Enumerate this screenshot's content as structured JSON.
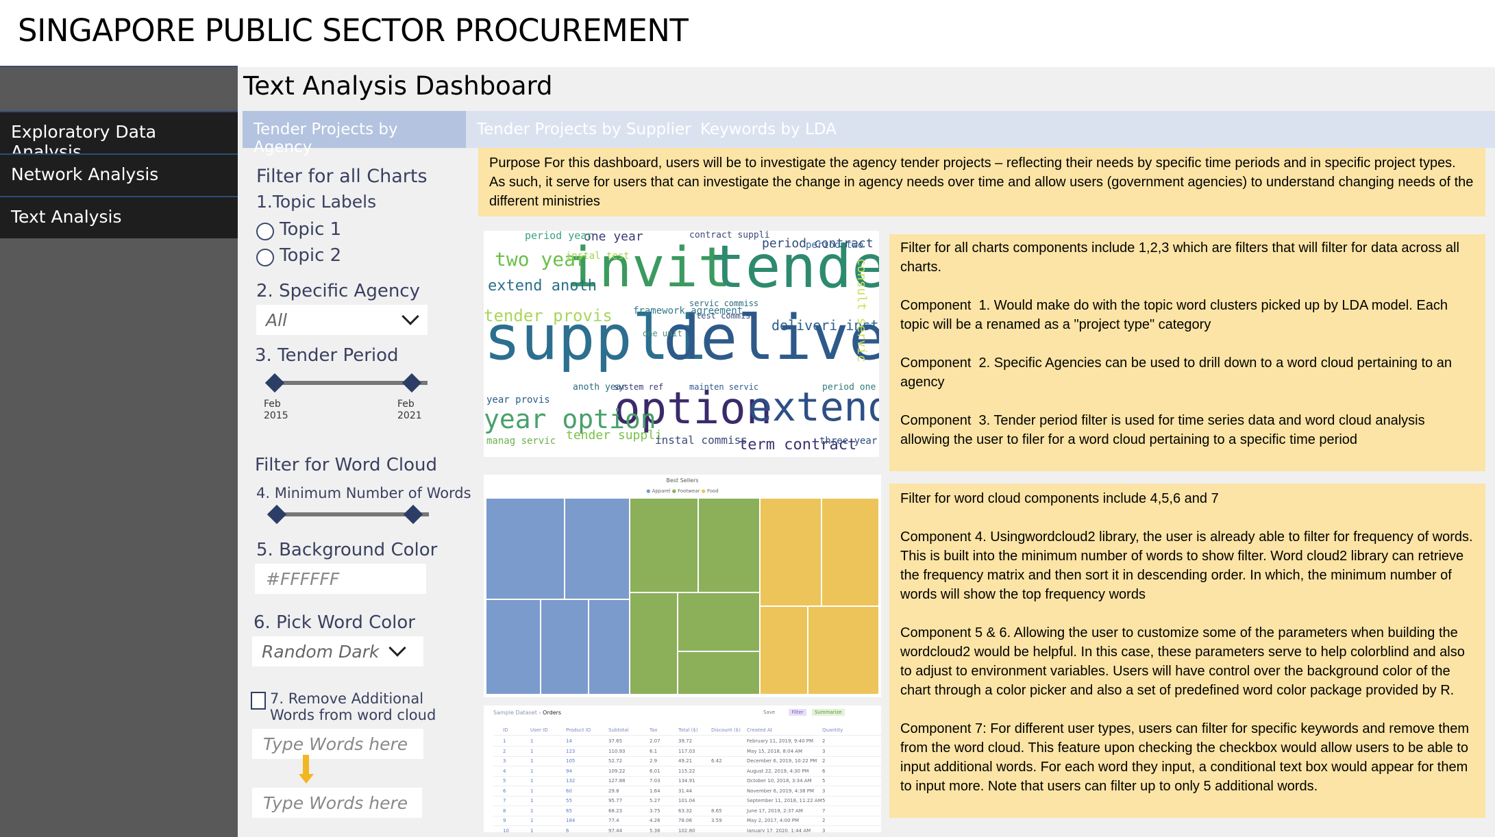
{
  "app": {
    "title": "SINGAPORE PUBLIC SECTOR PROCUREMENT"
  },
  "sidebar": {
    "items": [
      {
        "label": "Exploratory Data Analysis"
      },
      {
        "label": "Network Analysis"
      },
      {
        "label": "Text Analysis"
      }
    ]
  },
  "dashboard": {
    "title": "Text Analysis Dashboard"
  },
  "tabs": [
    {
      "label": "Tender Projects by Agency",
      "active": true
    },
    {
      "label": "Tender Projects by Supplier",
      "active": false
    },
    {
      "label": "Keywords by LDA",
      "active": false
    }
  ],
  "filters": {
    "all_heading": "Filter for all Charts",
    "topic_label": "1.Topic Labels",
    "topics": [
      "Topic 1",
      "Topic 2"
    ],
    "agency_label": "2. Specific Agency",
    "agency_value": "All",
    "period_label": "3. Tender Period",
    "period_start": {
      "month": "Feb",
      "year": "2015"
    },
    "period_end": {
      "month": "Feb",
      "year": "2021"
    },
    "wordcloud_heading": "Filter for Word Cloud",
    "min_words_label": "4. Minimum Number of Words",
    "bg_label": "5. Background Color",
    "bg_value": "#FFFFFF",
    "word_color_label": "6. Pick Word Color",
    "word_color_value": "Random Dark",
    "remove_label_1": "7. Remove Additional",
    "remove_label_2": "Words from word cloud",
    "input_placeholder_1": "Type Words here",
    "input_placeholder_2": "Type Words here"
  },
  "notes": {
    "purpose": "Purpose For this dashboard, users will be to investigate the agency tender projects – reflecting their needs by specific time periods and in specific project types. As such, it serve for users that can investigate the change in agency needs over time and allow users (government agencies) to understand changing needs of the different ministries",
    "all_charts": "Filter for all charts components include 1,2,3 which are filters that will filter for data across all charts.\n\nComponent  1. Would make do with the topic word clusters picked up by LDA model. Each topic will be a renamed as a \"project type\" category\n\nComponent  2. Specific Agencies can be used to drill down to a word cloud pertaining to an agency\n\nComponent  3. Tender period filter is used for time series data and word cloud analysis allowing the user to filer for a word cloud pertaining to a specific time period",
    "word_cloud": "Filter for word cloud components include 4,5,6 and 7\n\nComponent 4. Usingwordcloud2 library, the user is already able to filter for frequency of words. This is built into the minimum number of words to show filter. Word cloud2 library can retrieve the frequency matrix and then sort it in descending order. In which, the minimum number of words will show the top frequency words\n\nComponent 5 & 6. Allowing the user to customize some of the parameters when building the wordcloud2 would be helpful. In this case, these parameters serve to help colorblind and also to adjust to environment variables. Users will have control over the background color of the chart through a color picker and also a set of predefined word color package provided by R.\n\nComponent 7: For different user types, users can filter for specific keywords and remove them from the word cloud. This feature upon checking the checkbox would allow users to be able to input additional words. For each word they input, a conditional text box would appear for them to input more. Note that users can filter up to only 5 additional words."
  },
  "wordcloud": {
    "words": [
      {
        "text": "invit",
        "color": "#3b9a5f"
      },
      {
        "text": "tender",
        "color": "#2e8a6e"
      },
      {
        "text": "suppli",
        "color": "#2c6f8f"
      },
      {
        "text": "deliveri",
        "color": "#2e5a8a"
      },
      {
        "text": "option",
        "color": "#3b2a6a"
      },
      {
        "text": "extend",
        "color": "#2e4f86"
      },
      {
        "text": "year option",
        "color": "#4aa06a"
      },
      {
        "text": "two year",
        "color": "#6abf4a"
      },
      {
        "text": "tender provis",
        "color": "#a8d65a"
      },
      {
        "text": "extend anoth",
        "color": "#2a6f8a"
      },
      {
        "text": "period contract",
        "color": "#2f4a7a"
      },
      {
        "text": "deliveri instal",
        "color": "#2b5f8c"
      },
      {
        "text": "term contract",
        "color": "#3a3470"
      },
      {
        "text": "one year",
        "color": "#3a3a7a"
      },
      {
        "text": "consult servic",
        "color": "#c9e05a"
      },
      {
        "text": "period year",
        "color": "#3aa07a"
      },
      {
        "text": "contract suppli",
        "color": "#3a4a7a"
      },
      {
        "text": "framework agreement",
        "color": "#2f7a8a"
      },
      {
        "text": "servic commiss",
        "color": "#2e6a80"
      },
      {
        "text": "tender suppli",
        "color": "#7ac04a"
      },
      {
        "text": "instal commiss",
        "color": "#3a4a7a"
      },
      {
        "text": "three year",
        "color": "#2a4a7a"
      },
      {
        "text": "period two",
        "color": "#3a6a9a"
      },
      {
        "text": "manag servic",
        "color": "#6ab04a"
      },
      {
        "text": "year provis",
        "color": "#2a5a8a"
      },
      {
        "text": "period one",
        "color": "#2f7a7a"
      },
      {
        "text": "instal test",
        "color": "#9fd34a"
      },
      {
        "text": "anoth year",
        "color": "#2a6a7a"
      },
      {
        "text": "system ref",
        "color": "#3a3a7a"
      },
      {
        "text": "mainten servic",
        "color": "#2e5a8a"
      },
      {
        "text": "one unit",
        "color": "#4a8a7a"
      },
      {
        "text": "test commiss",
        "color": "#3a4a7a"
      }
    ]
  },
  "treemap": {
    "title": "Best Sellers",
    "legend": [
      "Apparel",
      "Footwear",
      "Food"
    ],
    "colors": [
      "#7b9bcc",
      "#8cb05a",
      "#ecc45a"
    ]
  },
  "sample_table": {
    "crumb_1": "Sample Dataset",
    "crumb_2": "Orders",
    "actions": [
      "Save",
      "Filter",
      "Summarize"
    ],
    "columns": [
      "ID",
      "User ID",
      "Product ID",
      "Subtotal",
      "Tax",
      "Total ($)",
      "Discount ($)",
      "Created At",
      "Quantity"
    ],
    "rows": [
      [
        "1",
        "1",
        "14",
        "37.65",
        "2.07",
        "39.72",
        "",
        "February 11, 2019, 9:40 PM",
        "2"
      ],
      [
        "2",
        "1",
        "123",
        "110.93",
        "6.1",
        "117.03",
        "",
        "May 15, 2018, 8:04 AM",
        "3"
      ],
      [
        "3",
        "1",
        "105",
        "52.72",
        "2.9",
        "49.21",
        "6.42",
        "December 6, 2019, 10:22 PM",
        "2"
      ],
      [
        "4",
        "1",
        "94",
        "109.22",
        "6.01",
        "115.22",
        "",
        "August 22, 2019, 4:30 PM",
        "6"
      ],
      [
        "5",
        "1",
        "132",
        "127.88",
        "7.03",
        "134.91",
        "",
        "October 10, 2018, 3:34 AM",
        "5"
      ],
      [
        "6",
        "1",
        "60",
        "29.8",
        "1.64",
        "31.44",
        "",
        "November 6, 2019, 4:38 PM",
        "3"
      ],
      [
        "7",
        "1",
        "55",
        "95.77",
        "5.27",
        "101.04",
        "",
        "September 11, 2018, 11:22 AM",
        "5"
      ],
      [
        "8",
        "1",
        "65",
        "68.23",
        "3.75",
        "63.32",
        "8.65",
        "June 17, 2019, 2:37 AM",
        "7"
      ],
      [
        "9",
        "1",
        "184",
        "77.4",
        "4.26",
        "78.06",
        "3.59",
        "May 2, 2017, 4:00 PM",
        "2"
      ],
      [
        "10",
        "1",
        "6",
        "97.44",
        "5.36",
        "102.80",
        "",
        "January 17, 2020, 1:44 AM",
        "3"
      ]
    ]
  }
}
